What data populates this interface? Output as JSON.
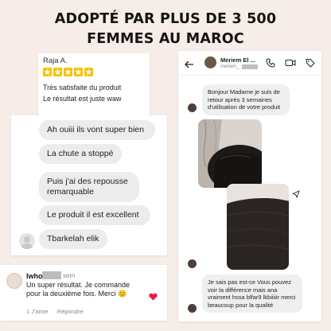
{
  "headline": {
    "line1": "ADOPTÉ PAR PLUS DE 3 500",
    "line2": "FEMMES AU MAROC"
  },
  "review": {
    "name": "Raja A.",
    "stars": 5,
    "line1": "Très satisfaite du produit",
    "line2": "Le résultat est juste waw"
  },
  "chat": {
    "messages": [
      "Ah ouiii ils vont super bien",
      "La chute a stoppé",
      "Puis j'ai des repousse remarquable",
      "Le produit il est excellent",
      "Tbarkelah elik"
    ]
  },
  "comment": {
    "username": "lwho",
    "time": "sem",
    "text": "Un super résultat. Je commande pour la deuxième fois. Merci 😊",
    "likes": "1 J'aime",
    "reply": "Répondre"
  },
  "dm": {
    "contact_name": "Meriem El ...",
    "contact_handle": "meriem_",
    "message1": "Bonjour Madame je suis de retour après 3 semaines d'utilisation de votre produit",
    "message2": "Je sais pas est-ce Vous pouvez voir la différence mais ana vraiment hssa blfar9 lkbiiiiir merci beaucoup pour la qualité"
  },
  "colors": {
    "background": "#f6ece8",
    "star": "#f7c200",
    "heart": "#ed1c40",
    "bubble": "#ececec"
  },
  "icons": [
    "star-icon",
    "back-arrow-icon",
    "phone-icon",
    "video-icon",
    "tag-icon",
    "heart-icon",
    "share-icon",
    "user-avatar-icon"
  ]
}
